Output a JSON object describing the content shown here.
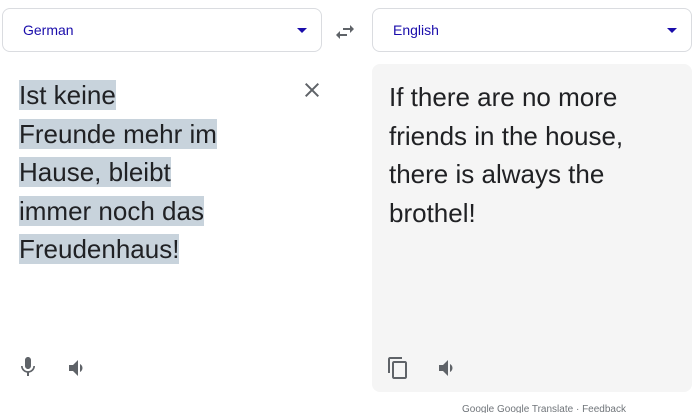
{
  "source": {
    "language": "German",
    "lines": [
      "Ist keine",
      "Freunde mehr im",
      "Hause, bleibt",
      "immer noch das",
      "Freudenhaus!"
    ]
  },
  "target": {
    "language": "English",
    "lines": [
      "If there are no more",
      "friends in the house,",
      "there is always the",
      "brothel!"
    ]
  },
  "icons": {
    "swap": "swap-languages-icon",
    "clear": "close-icon",
    "mic": "microphone-icon",
    "source_listen": "speaker-icon",
    "copy": "copy-icon",
    "target_listen": "speaker-icon"
  },
  "colors": {
    "language_text": "#1a0dab",
    "selection_highlight": "#c8d3dc",
    "output_background": "#f5f5f5",
    "icon": "#5f6368"
  },
  "footer": {
    "text": "Google Google Translate · Feedback"
  }
}
